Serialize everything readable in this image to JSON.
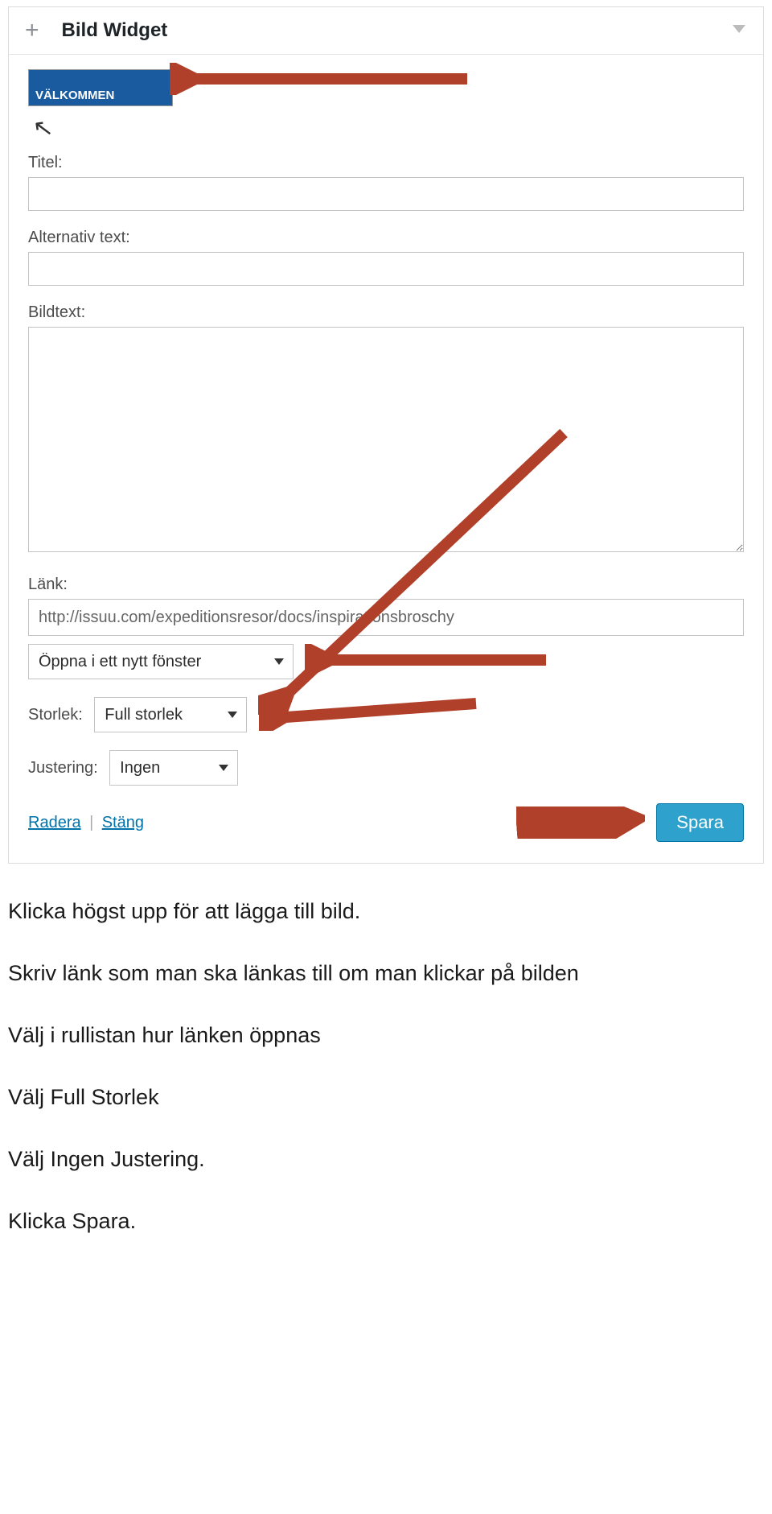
{
  "widget": {
    "title": "Bild Widget",
    "thumb_text": "VÄLKOMMEN",
    "labels": {
      "titel": "Titel:",
      "alt": "Alternativ text:",
      "bildtext": "Bildtext:",
      "lank": "Länk:",
      "storlek": "Storlek:",
      "justering": "Justering:"
    },
    "values": {
      "titel": "",
      "alt": "",
      "bildtext": "",
      "lank": "http://issuu.com/expeditionsresor/docs/inspirationsbroschy"
    },
    "selects": {
      "open_mode": "Öppna i ett nytt fönster",
      "storlek": "Full storlek",
      "justering": "Ingen"
    },
    "actions": {
      "radera": "Radera",
      "stang": "Stäng",
      "spara": "Spara"
    }
  },
  "instructions": {
    "l1": "Klicka högst upp för att lägga till bild.",
    "l2": "Skriv länk som man ska länkas till om man klickar på bilden",
    "l3": "Välj i rullistan hur länken öppnas",
    "l4": "Välj Full Storlek",
    "l5": "Välj Ingen Justering.",
    "l6": "Klicka Spara."
  }
}
